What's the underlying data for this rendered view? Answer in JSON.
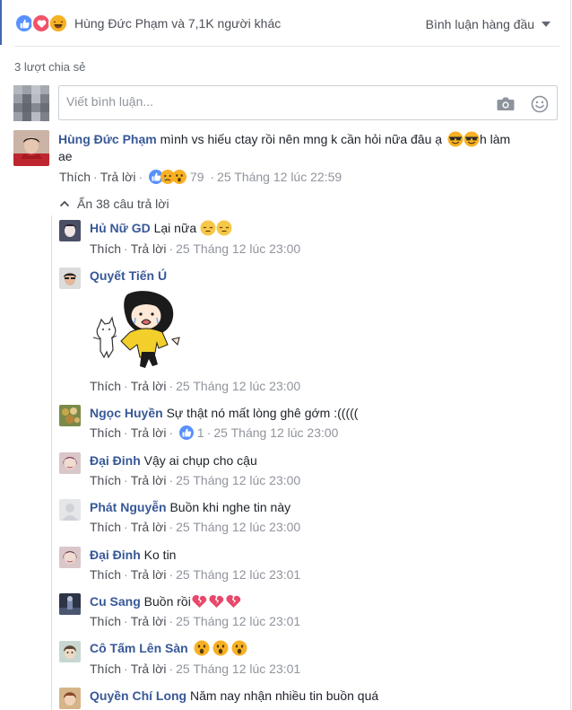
{
  "reactions": {
    "icons": [
      "like-icon",
      "love-icon",
      "haha-icon"
    ],
    "summary": "Hùng Đức Phạm và 7,1K người khác",
    "sort_label": "Bình luận hàng đầu"
  },
  "shares": "3 lượt chia sẻ",
  "composer": {
    "placeholder": "Viết bình luận..."
  },
  "main_comment": {
    "author": "Hùng Đức Phạm",
    "text_1": "mình vs hiếu ctay rồi nên mng k cần hỏi nữa đâu ạ",
    "text_2": "h làm",
    "text_3": "ae",
    "like": "Thích",
    "reply": "Trả lời",
    "reaction_count": "79",
    "timestamp": "25 Tháng 12 lúc 22:59"
  },
  "hide_replies": "Ẩn 38 câu trả lời",
  "replies": [
    {
      "author": "Hủ Nữ GD",
      "text": "Lại nữa",
      "like": "Thích",
      "reply": "Trả lời",
      "time": "25 Tháng 12 lúc 23:00"
    },
    {
      "author": "Quyết Tiến Ú",
      "text": "",
      "like": "Thích",
      "reply": "Trả lời",
      "time": "25 Tháng 12 lúc 23:00"
    },
    {
      "author": "Ngọc Huyền",
      "text": "Sự thật nó mất lòng ghê gớm :(((((",
      "like": "Thích",
      "reply": "Trả lời",
      "reaction_count": "1",
      "time": "25 Tháng 12 lúc 23:00"
    },
    {
      "author": "Đại Đinh",
      "text": "Vậy ai chụp cho cậu",
      "like": "Thích",
      "reply": "Trả lời",
      "time": "25 Tháng 12 lúc 23:00"
    },
    {
      "author": "Phát Nguyễn",
      "text": "Buồn khi nghe tin này",
      "like": "Thích",
      "reply": "Trả lời",
      "time": "25 Tháng 12 lúc 23:00"
    },
    {
      "author": "Đại Đinh",
      "text": "Ko tin",
      "like": "Thích",
      "reply": "Trả lời",
      "time": "25 Tháng 12 lúc 23:01"
    },
    {
      "author": "Cu Sang",
      "text": "Buồn rồi",
      "like": "Thích",
      "reply": "Trả lời",
      "time": "25 Tháng 12 lúc 23:01"
    },
    {
      "author": "Cô Tấm Lên Sàn",
      "text": "",
      "like": "Thích",
      "reply": "Trả lời",
      "time": "25 Tháng 12 lúc 23:01"
    },
    {
      "author": "Quyền Chí Long",
      "text": "Năm nay nhận nhiều tin buồn quá"
    }
  ],
  "colors": {
    "link": "#385898",
    "meta": "#90949c",
    "like_blue": "#5890ff",
    "love_red": "#f25268",
    "emoji_yellow": "#f7b125",
    "heart_broken": "#e8486a"
  }
}
